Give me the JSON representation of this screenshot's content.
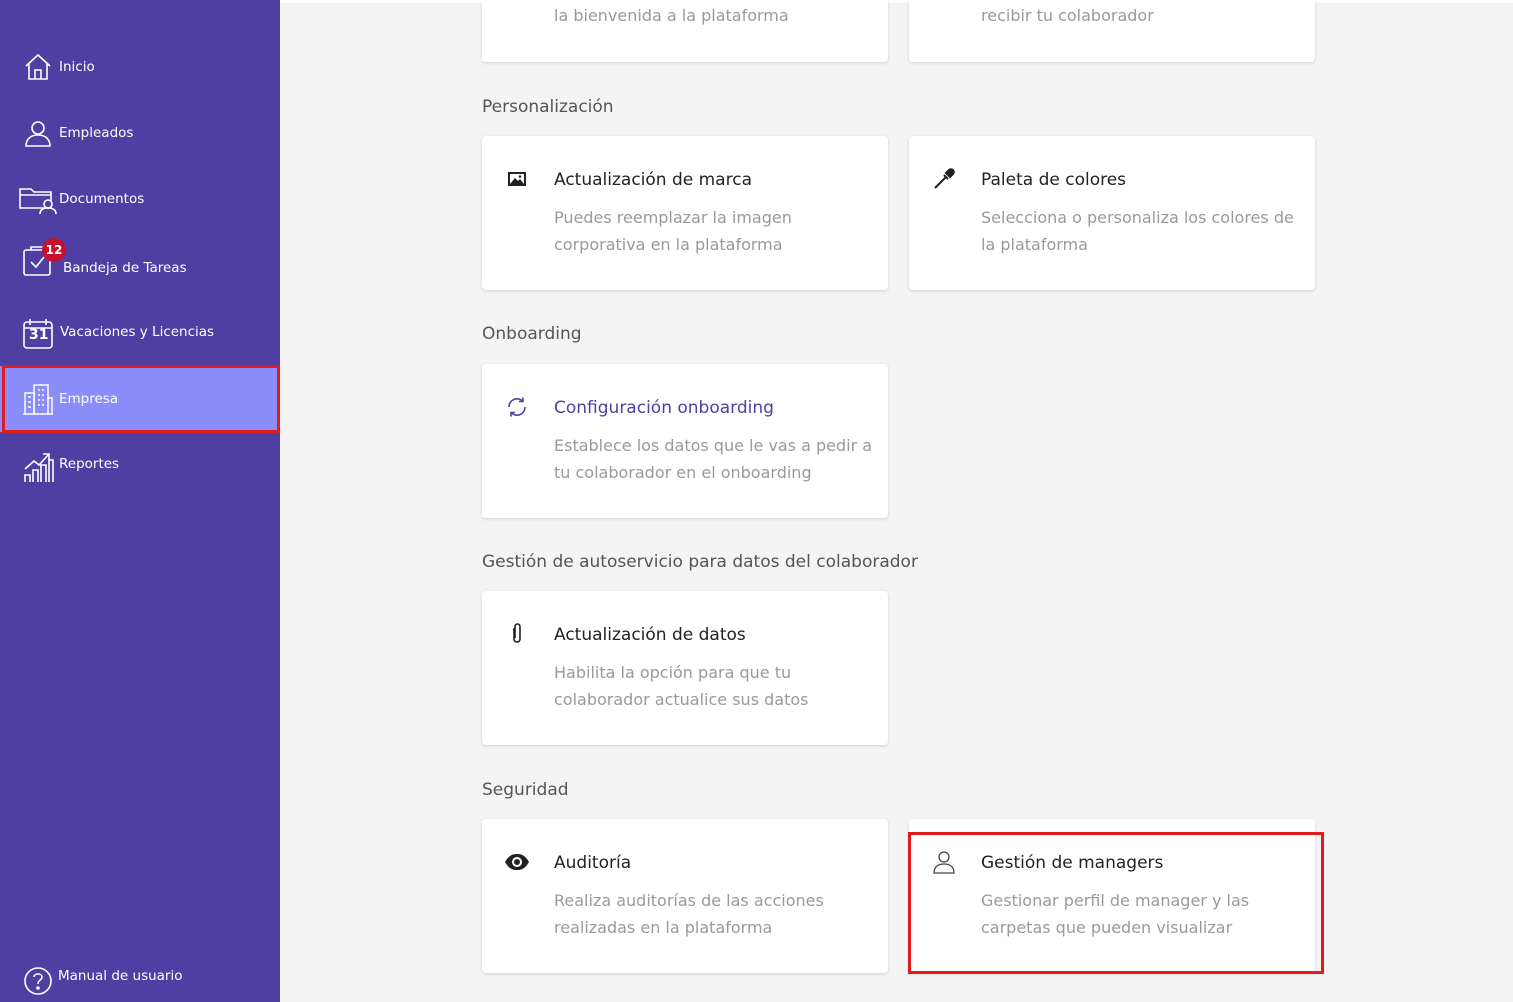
{
  "sidebar": {
    "items": [
      {
        "label": "Inicio",
        "icon": "home-icon"
      },
      {
        "label": "Empleados",
        "icon": "user-icon"
      },
      {
        "label": "Documentos",
        "icon": "folder-user-icon"
      },
      {
        "label": "Bandeja de Tareas",
        "icon": "task-clipboard-icon",
        "badge": "12"
      },
      {
        "label": "Vacaciones y Licencias",
        "icon": "calendar-icon",
        "calendar_day": "31"
      },
      {
        "label": "Empresa",
        "icon": "building-icon",
        "active": true
      },
      {
        "label": "Reportes",
        "icon": "chart-growth-icon"
      }
    ],
    "help": {
      "label": "Manual de usuario",
      "icon": "help-circle-icon"
    }
  },
  "main": {
    "top_cards": [
      {
        "description": "la bienvenida a la plataforma"
      },
      {
        "description": "recibir tu colaborador"
      }
    ],
    "sections": [
      {
        "title": "Personalización",
        "cards": [
          {
            "title": "Actualización de marca",
            "description": "Puedes reemplazar la imagen corporativa en la plataforma",
            "icon": "image-icon"
          },
          {
            "title": "Paleta de colores",
            "description": "Selecciona o personaliza los colores de la plataforma",
            "icon": "eyedropper-icon"
          }
        ]
      },
      {
        "title": "Onboarding",
        "cards": [
          {
            "title": "Configuración onboarding",
            "description": "Establece los datos que le vas a pedir a tu colaborador en el onboarding",
            "icon": "refresh-icon"
          }
        ]
      },
      {
        "title": "Gestión de autoservicio para datos del colaborador",
        "cards": [
          {
            "title": "Actualización de datos",
            "description": "Habilita la opción para que tu colaborador actualice sus datos",
            "icon": "paperclip-icon"
          }
        ]
      },
      {
        "title": "Seguridad",
        "cards": [
          {
            "title": "Auditoría",
            "description": "Realiza auditorías de las acciones realizadas en la plataforma",
            "icon": "eye-icon"
          },
          {
            "title": "Gestión de managers",
            "description": "Gestionar perfil de manager y las carpetas que pueden visualizar",
            "icon": "person-outline-icon"
          }
        ]
      }
    ]
  },
  "colors": {
    "sidebar_bg": "#4f3fa3",
    "sidebar_active": "#8b8dfb",
    "badge": "#c8102e",
    "highlight_outline": "#e01b1b",
    "accent_text": "#4f3fa3"
  }
}
